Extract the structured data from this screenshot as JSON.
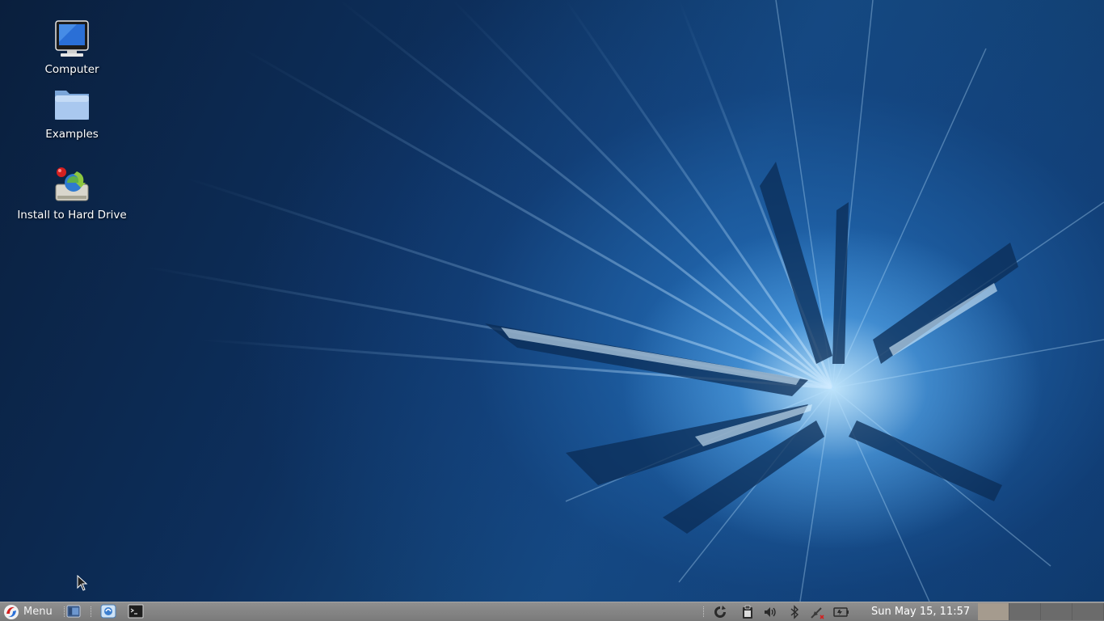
{
  "desktop": {
    "icons": [
      {
        "label": "Computer",
        "icon": "computer-icon"
      },
      {
        "label": "Examples",
        "icon": "folder-icon"
      },
      {
        "label": "Install to Hard Drive",
        "icon": "installer-icon"
      }
    ]
  },
  "taskbar": {
    "menu_label": "Menu",
    "launchers": [
      "file-manager-icon",
      "control-center-icon",
      "terminal-icon"
    ],
    "tray_icons": [
      "update-manager-icon",
      "clipboard-icon",
      "volume-icon",
      "bluetooth-icon",
      "network-disconnected-icon",
      "battery-icon"
    ],
    "clock": "Sun May 15, 11:57",
    "workspaces": {
      "count": 4,
      "active_index": 0
    }
  },
  "colors": {
    "taskbar": "#858585",
    "wallpaper_accent": "#3a8fd8",
    "active_workspace": "#a59b8e"
  }
}
